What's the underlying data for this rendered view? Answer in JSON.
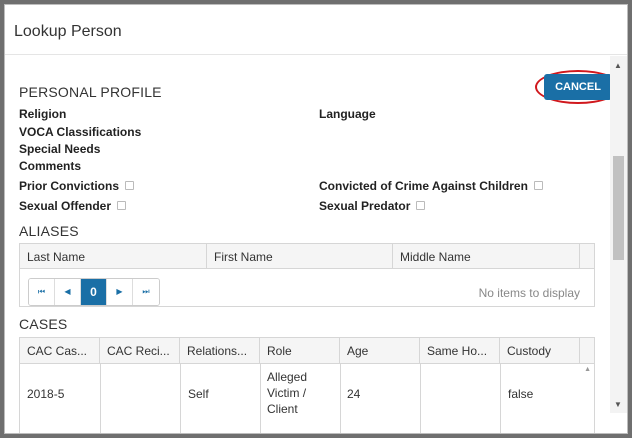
{
  "dialog": {
    "title": "Lookup Person",
    "cancel_label": "CANCEL"
  },
  "profile": {
    "section_title": "PERSONAL PROFILE",
    "religion": "Religion",
    "language": "Language",
    "voca": "VOCA Classifications",
    "special_needs": "Special Needs",
    "comments": "Comments",
    "prior_convictions": "Prior Convictions",
    "convicted_crime": "Convicted of Crime Against Children",
    "sexual_offender": "Sexual Offender",
    "sexual_predator": "Sexual Predator"
  },
  "aliases": {
    "section_title": "ALIASES",
    "columns": [
      "Last Name",
      "First Name",
      "Middle Name"
    ],
    "pager": {
      "first": "⏮",
      "prev": "◀",
      "page": "0",
      "next": "▶",
      "last": "⏭"
    },
    "empty_text": "No items to display"
  },
  "cases": {
    "section_title": "CASES",
    "columns": [
      "CAC Cas...",
      "CAC Reci...",
      "Relations...",
      "Role",
      "Age",
      "Same Ho...",
      "Custody"
    ],
    "rows": [
      {
        "case": "2018-5",
        "recipient": "",
        "relationship": "Self",
        "role_lines": [
          "Alleged",
          "Victim /",
          "Client"
        ],
        "age": "24",
        "same_household": "",
        "custody": "false"
      }
    ]
  },
  "scroll": {
    "up": "▲",
    "down": "▼"
  }
}
